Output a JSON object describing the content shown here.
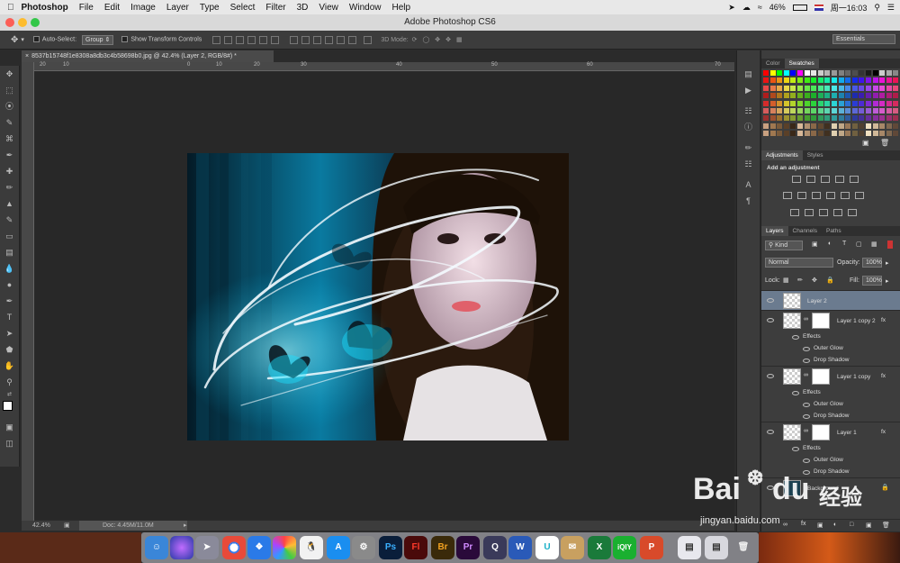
{
  "menubar": {
    "apple": "",
    "app": "Photoshop",
    "items": [
      "File",
      "Edit",
      "Image",
      "Layer",
      "Type",
      "Select",
      "Filter",
      "3D",
      "View",
      "Window",
      "Help"
    ],
    "battery": "46%",
    "clock": "周一16:03"
  },
  "window": {
    "title": "Adobe Photoshop CS6"
  },
  "options": {
    "auto_select": "Auto-Select:",
    "auto_select_value": "Group",
    "show_transform": "Show Transform Controls",
    "mode_3d": "3D Mode:",
    "workspace": "Essentials"
  },
  "document": {
    "tab": "8537b15748f1e8308a8db3c4b58698b0.jpg @ 42.4% (Layer 2, RGB/8#) *",
    "zoom": "42.4%",
    "doc_size": "Doc: 4.45M/11.0M"
  },
  "ruler": {
    "h_ticks": [
      "20",
      "10",
      "0",
      "10",
      "20",
      "30",
      "40",
      "50",
      "60",
      "70"
    ]
  },
  "panels": {
    "color_tab": "Color",
    "swatches_tab": "Swatches",
    "adjustments_tab": "Adjustments",
    "styles_tab": "Styles",
    "add_adjustment": "Add an adjustment",
    "layers_tab": "Layers",
    "channels_tab": "Channels",
    "paths_tab": "Paths",
    "kind": "Kind",
    "blend_mode": "Normal",
    "opacity_label": "Opacity:",
    "opacity": "100%",
    "lock_label": "Lock:",
    "fill_label": "Fill:",
    "fill": "100%"
  },
  "layers": [
    {
      "name": "Layer 2"
    },
    {
      "name": "Layer 1 copy 2",
      "effects": [
        "Effects",
        "Outer Glow",
        "Drop Shadow"
      ]
    },
    {
      "name": "Layer 1 copy",
      "effects": [
        "Effects",
        "Outer Glow",
        "Drop Shadow"
      ]
    },
    {
      "name": "Layer 1",
      "effects": [
        "Effects",
        "Outer Glow",
        "Drop Shadow"
      ]
    },
    {
      "name": "Background"
    }
  ],
  "watermark": {
    "brand": "Bai",
    "paw": "du",
    "cn": "经验",
    "url": "jingyan.baidu.com"
  },
  "dock": {
    "ps": "Ps",
    "fl": "Fl",
    "br": "Br",
    "pr": "Pr",
    "x": "X",
    "p": "P",
    "q": "Q",
    "w": "W",
    "u": "U",
    "iqiyi": "iQIY"
  }
}
